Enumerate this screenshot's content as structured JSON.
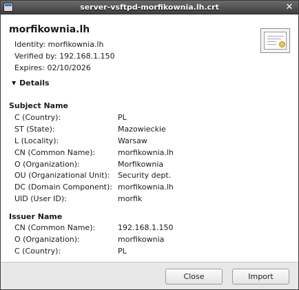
{
  "window": {
    "title": "server-vsftpd-morfikownia.lh.crt",
    "close_glyph": "✕"
  },
  "cert": {
    "name": "morfikownia.lh",
    "identity": "Identity: morfikownia.lh",
    "verified_by": "Verified by: 192.168.1.150",
    "expires": "Expires: 02/10/2026",
    "icon": "certificate-icon"
  },
  "details": {
    "toggle_label": "Details",
    "arrow_glyph": "▼"
  },
  "subject": {
    "title": "Subject Name",
    "rows": [
      {
        "key": "C (Country):",
        "value": "PL"
      },
      {
        "key": "ST (State):",
        "value": "Mazowieckie"
      },
      {
        "key": "L (Locality):",
        "value": "Warsaw"
      },
      {
        "key": "CN (Common Name):",
        "value": "morfikownia.lh"
      },
      {
        "key": "O (Organization):",
        "value": "Morfikownia"
      },
      {
        "key": "OU (Organizational Unit):",
        "value": "Security dept."
      },
      {
        "key": "DC (Domain Component):",
        "value": "morfikownia.lh"
      },
      {
        "key": "UID (User ID):",
        "value": "morfik"
      }
    ]
  },
  "issuer": {
    "title": "Issuer Name",
    "rows": [
      {
        "key": "CN (Common Name):",
        "value": "192.168.1.150"
      },
      {
        "key": "O (Organization):",
        "value": "morfikownia"
      },
      {
        "key": "C (Country):",
        "value": "PL"
      }
    ]
  },
  "buttons": {
    "close_label": "Close",
    "import_label": "Import"
  }
}
